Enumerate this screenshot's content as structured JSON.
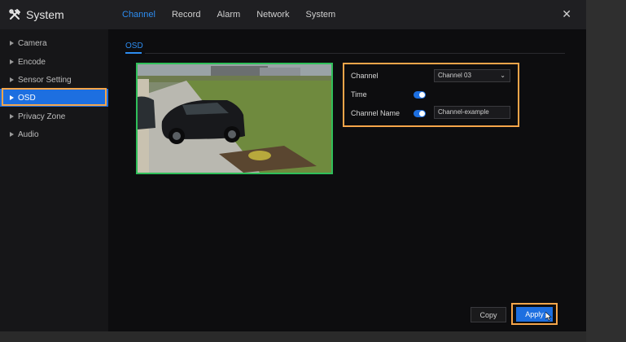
{
  "app": {
    "title": "System"
  },
  "tabs": [
    "Channel",
    "Record",
    "Alarm",
    "Network",
    "System"
  ],
  "active_tab": "Channel",
  "sidebar": {
    "items": [
      {
        "label": "Camera"
      },
      {
        "label": "Encode"
      },
      {
        "label": "Sensor Setting"
      },
      {
        "label": "OSD",
        "active": true
      },
      {
        "label": "Privacy Zone"
      },
      {
        "label": "Audio"
      }
    ]
  },
  "subtab": {
    "label": "OSD"
  },
  "form": {
    "channel_label": "Channel",
    "channel_value": "Channel 03",
    "time_label": "Time",
    "time_enabled": true,
    "channel_name_label": "Channel Name",
    "channel_name_enabled": true,
    "channel_name_value": "Channel-example"
  },
  "buttons": {
    "copy": "Copy",
    "apply": "Apply"
  },
  "colors": {
    "accent": "#1d6fe0",
    "highlight": "#f5a54a",
    "preview_border": "#2fbf5a"
  }
}
